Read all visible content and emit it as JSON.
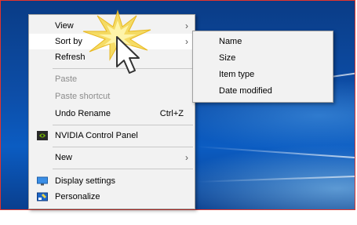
{
  "context_menu": {
    "items": [
      {
        "label": "View",
        "has_submenu": true
      },
      {
        "label": "Sort by",
        "has_submenu": true,
        "highlighted": true
      },
      {
        "label": "Refresh"
      },
      {
        "label": "Paste",
        "disabled": true
      },
      {
        "label": "Paste shortcut",
        "disabled": true
      },
      {
        "label": "Undo Rename",
        "shortcut": "Ctrl+Z"
      },
      {
        "label": "NVIDIA Control Panel",
        "icon": "nvidia-icon"
      },
      {
        "label": "New",
        "has_submenu": true
      },
      {
        "label": "Display settings",
        "icon": "display-icon"
      },
      {
        "label": "Personalize",
        "icon": "personalize-icon"
      }
    ]
  },
  "sort_by_submenu": {
    "items": [
      {
        "label": "Name"
      },
      {
        "label": "Size"
      },
      {
        "label": "Item type"
      },
      {
        "label": "Date modified"
      }
    ]
  },
  "colors": {
    "desktop_blue": "#0b4ea8",
    "menu_bg": "#f2f2f2",
    "border_red": "#e3342c"
  }
}
